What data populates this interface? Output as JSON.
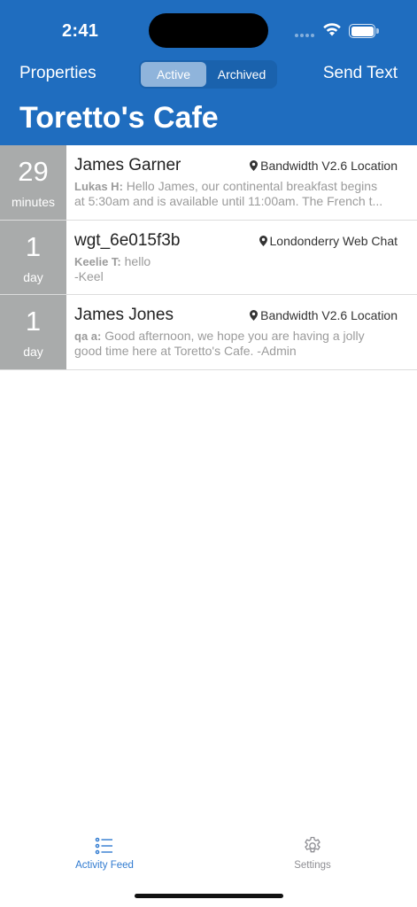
{
  "status_bar": {
    "time": "2:41"
  },
  "nav": {
    "left_label": "Properties",
    "right_label": "Send Text",
    "segments": [
      "Active",
      "Archived"
    ],
    "selected_segment": "Active",
    "title": "Toretto's Cafe"
  },
  "colors": {
    "header": "#1f6dbf",
    "age_block": "#a9abab",
    "tab_active": "#2f7ad0"
  },
  "conversations": [
    {
      "age_value": "29",
      "age_unit": "minutes",
      "name": "James Garner",
      "location": "Bandwidth V2.6 Location",
      "sender": "Lukas H:",
      "message_line1": " Hello James, our continental breakfast begins",
      "message_line2": "at 5:30am and is available until 11:00am. The French t..."
    },
    {
      "age_value": "1",
      "age_unit": "day",
      "name": "wgt_6e015f3b",
      "location": "Londonderry Web Chat",
      "sender": "Keelie T:",
      "message_line1": " hello",
      "message_line2": "-Keel"
    },
    {
      "age_value": "1",
      "age_unit": "day",
      "name": "James Jones",
      "location": "Bandwidth V2.6 Location",
      "sender": "qa a:",
      "message_line1": "  Good afternoon, we hope you are having a jolly",
      "message_line2": "good time here at Toretto's Cafe.  -Admin"
    }
  ],
  "tabs": [
    {
      "label": "Activity Feed",
      "icon": "list-icon",
      "selected": true
    },
    {
      "label": "Settings",
      "icon": "gear-icon",
      "selected": false
    }
  ]
}
